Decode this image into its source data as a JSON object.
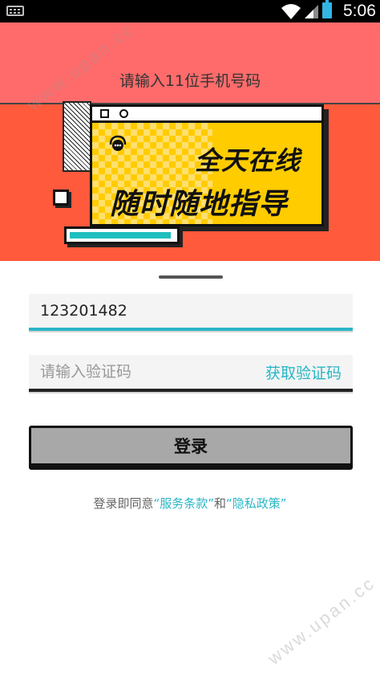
{
  "status_bar": {
    "time": "5:06",
    "icons": [
      "keyboard-icon",
      "wifi-icon",
      "signal-icon",
      "battery-icon"
    ]
  },
  "banner": {
    "hint": "请输入11位手机号码",
    "slogan_line1": "全天在线",
    "slogan_line2": "随时随地指导",
    "accent_color": "#ffcc00",
    "background_color": "#ff5a3c"
  },
  "form": {
    "phone_value": "123201482",
    "code_placeholder": "请输入验证码",
    "get_code_label": "获取验证码",
    "login_label": "登录"
  },
  "agreement": {
    "prefix": "登录即同意",
    "terms": "“服务条款”",
    "and": "和",
    "privacy": "“隐私政策”"
  },
  "watermark": {
    "text": "www.upan.cc"
  },
  "colors": {
    "accent": "#29b6c6",
    "button": "#a8a8a8"
  }
}
